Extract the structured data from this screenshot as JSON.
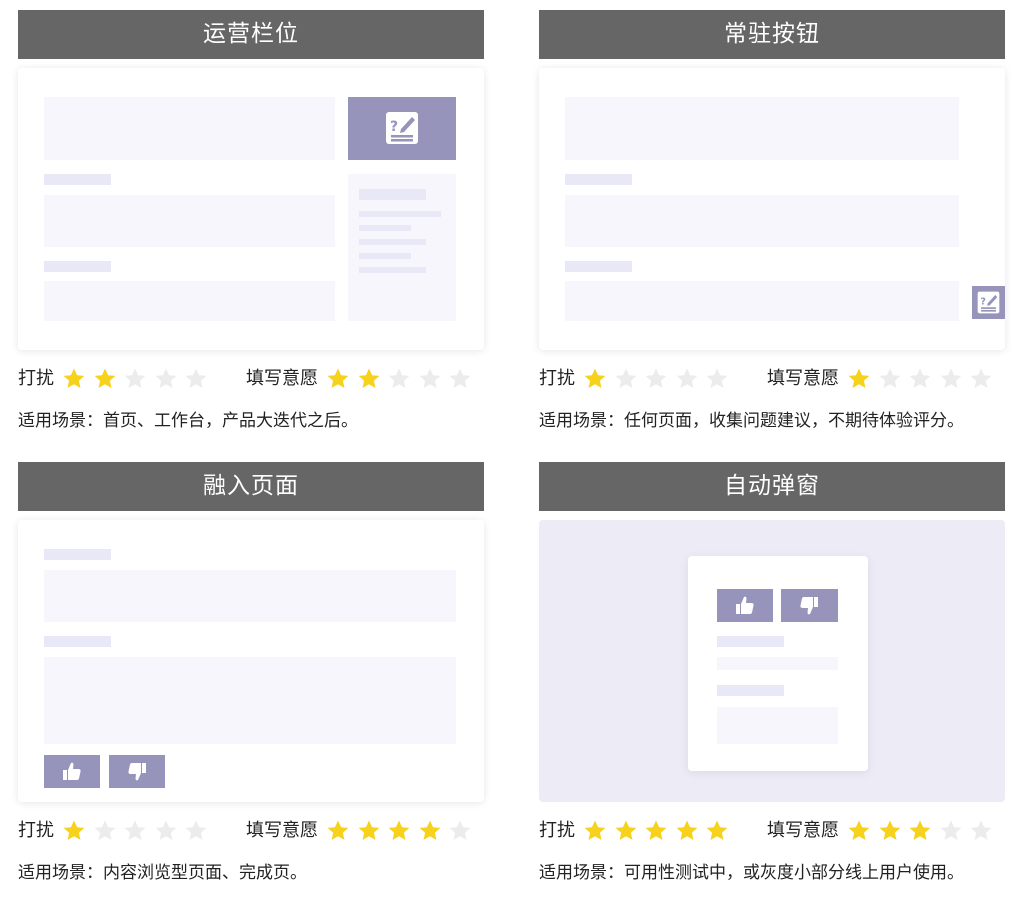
{
  "panels": [
    {
      "title": "运营栏位",
      "disturb_label": "打扰",
      "disturb_rating": 2,
      "willing_label": "填写意愿",
      "willing_rating": 2,
      "scenario": "适用场景：首页、工作台，产品大迭代之后。"
    },
    {
      "title": "常驻按钮",
      "disturb_label": "打扰",
      "disturb_rating": 1,
      "willing_label": "填写意愿",
      "willing_rating": 1,
      "scenario": "适用场景：任何页面，收集问题建议，不期待体验评分。"
    },
    {
      "title": "融入页面",
      "disturb_label": "打扰",
      "disturb_rating": 1,
      "willing_label": "填写意愿",
      "willing_rating": 4,
      "scenario": "适用场景：内容浏览型页面、完成页。"
    },
    {
      "title": "自动弹窗",
      "disturb_label": "打扰",
      "disturb_rating": 5,
      "willing_label": "填写意愿",
      "willing_rating": 3,
      "scenario": "适用场景：可用性测试中，或灰度小部分线上用户使用。"
    }
  ],
  "max_rating": 5,
  "colors": {
    "header_bg": "#666666",
    "star_filled": "#f7d21c",
    "star_empty": "#ececec",
    "accent": "#9694bb",
    "placeholder": "#f7f6fd",
    "placeholder_dark": "#e9e8f6",
    "modal_backdrop": "#edecf6"
  },
  "icons": {
    "feedback": "feedback-edit-icon",
    "thumb_up": "thumbs-up-icon",
    "thumb_down": "thumbs-down-icon",
    "star": "star-icon"
  }
}
